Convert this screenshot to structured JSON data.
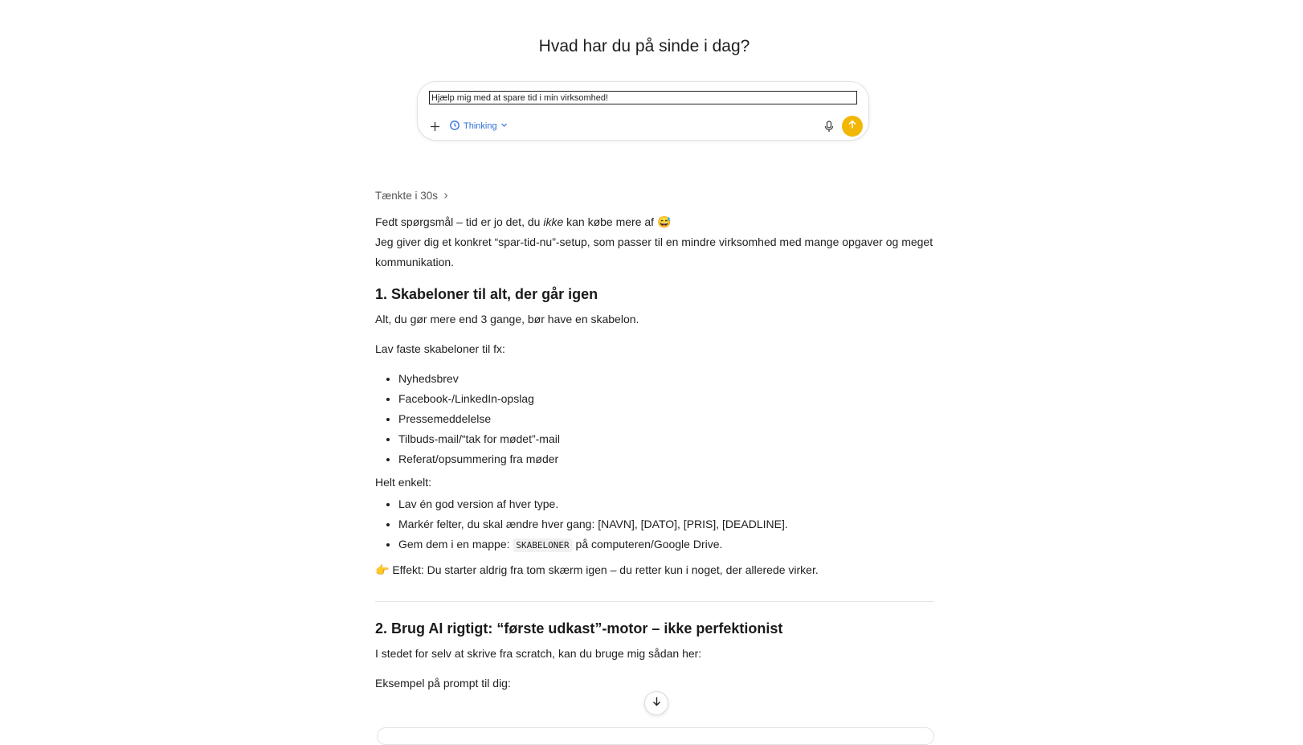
{
  "header": {
    "greeting": "Hvad har du på sinde i dag?"
  },
  "composer": {
    "input_value": "Hjælp mig med at spare tid i min virksomhed!",
    "plus_icon": "plus-icon",
    "thinking_label": "Thinking",
    "mic_icon": "microphone-icon",
    "send_icon": "arrow-up-icon",
    "accent_color": "#f2b705",
    "thinking_color": "#2f6fd6"
  },
  "response": {
    "thought_label": "Tænkte i 30s",
    "intro_before": "Fedt spørgsmål – tid er jo det, du ",
    "intro_em": "ikke",
    "intro_after": " kan købe mere af 😅",
    "intro_line2": "Jeg giver dig et konkret “spar-tid-nu”-setup, som passer til en mindre virksomhed med mange opgaver og meget kommunikation.",
    "section1": {
      "heading": "1. Skabeloner til alt, der går igen",
      "para1": "Alt, du gør mere end 3 gange, bør have en skabelon.",
      "para2": "Lav faste skabeloner til fx:",
      "items": [
        "Nyhedsbrev",
        "Facebook-/LinkedIn-opslag",
        "Pressemeddelelse",
        "Tilbuds-mail/“tak for mødet”-mail",
        "Referat/opsummering fra møder"
      ],
      "subhead": "Helt enkelt:",
      "steps": {
        "step1": "Lav én god version af hver type.",
        "step2": "Markér felter, du skal ændre hver gang: [NAVN], [DATO], [PRIS], [DEADLINE].",
        "step3_before": "Gem dem i en mappe: ",
        "step3_code": "SKABELONER",
        "step3_after": " på computeren/Google Drive."
      },
      "effect_emoji": "👉",
      "effect_text": " Effekt: Du starter aldrig fra tom skærm igen – du retter kun i noget, der allerede virker."
    },
    "section2": {
      "heading": "2. Brug AI rigtigt: “første udkast”-motor – ikke perfektionist",
      "para1": "I stedet for selv at skrive fra scratch, kan du bruge mig sådan her:",
      "para2": "Eksempel på prompt til dig:"
    }
  },
  "scroll_button": {
    "icon": "arrow-down-icon"
  }
}
